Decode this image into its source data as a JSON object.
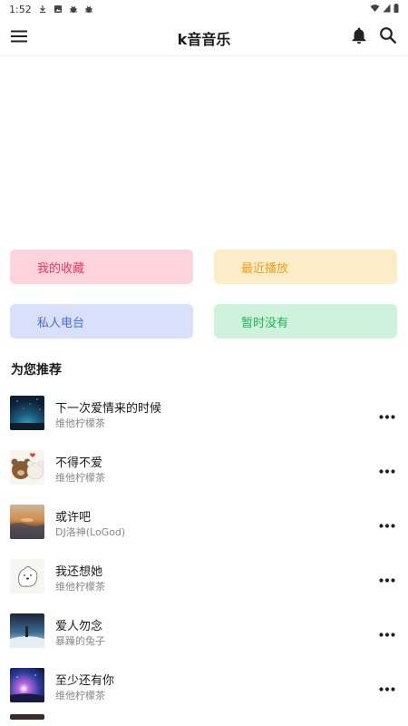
{
  "status_bar": {
    "time": "1:52",
    "left_icons": [
      "download-icon",
      "photo-icon",
      "bug-icon",
      "bug-icon"
    ],
    "right_icons": [
      "wifi-icon",
      "signal-icon",
      "battery-icon"
    ]
  },
  "app_bar": {
    "title": "k音音乐",
    "menu_icon": "hamburger-menu-icon",
    "bell_icon": "bell-icon",
    "search_icon": "search-icon"
  },
  "quick_actions": [
    {
      "label": "我的收藏",
      "color": "#e6385b",
      "bg": "#ffd3dc"
    },
    {
      "label": "最近播放",
      "color": "#f0a11a",
      "bg": "#fdecc8"
    },
    {
      "label": "私人电台",
      "color": "#4a6ae6",
      "bg": "#d8e0fb"
    },
    {
      "label": "暂时没有",
      "color": "#1fb455",
      "bg": "#cff2dc"
    }
  ],
  "section": {
    "title": "为您推荐"
  },
  "songs": [
    {
      "title": "下一次爱情来的时候",
      "artist": "维他柠檬茶"
    },
    {
      "title": "不得不爱",
      "artist": "维他柠檬茶"
    },
    {
      "title": "或许吧",
      "artist": "DJ洛神(LoGod)"
    },
    {
      "title": "我还想她",
      "artist": "维他柠檬茶"
    },
    {
      "title": "爱人勿念",
      "artist": "暴躁的兔子"
    },
    {
      "title": "至少还有你",
      "artist": "维他柠檬茶"
    }
  ]
}
